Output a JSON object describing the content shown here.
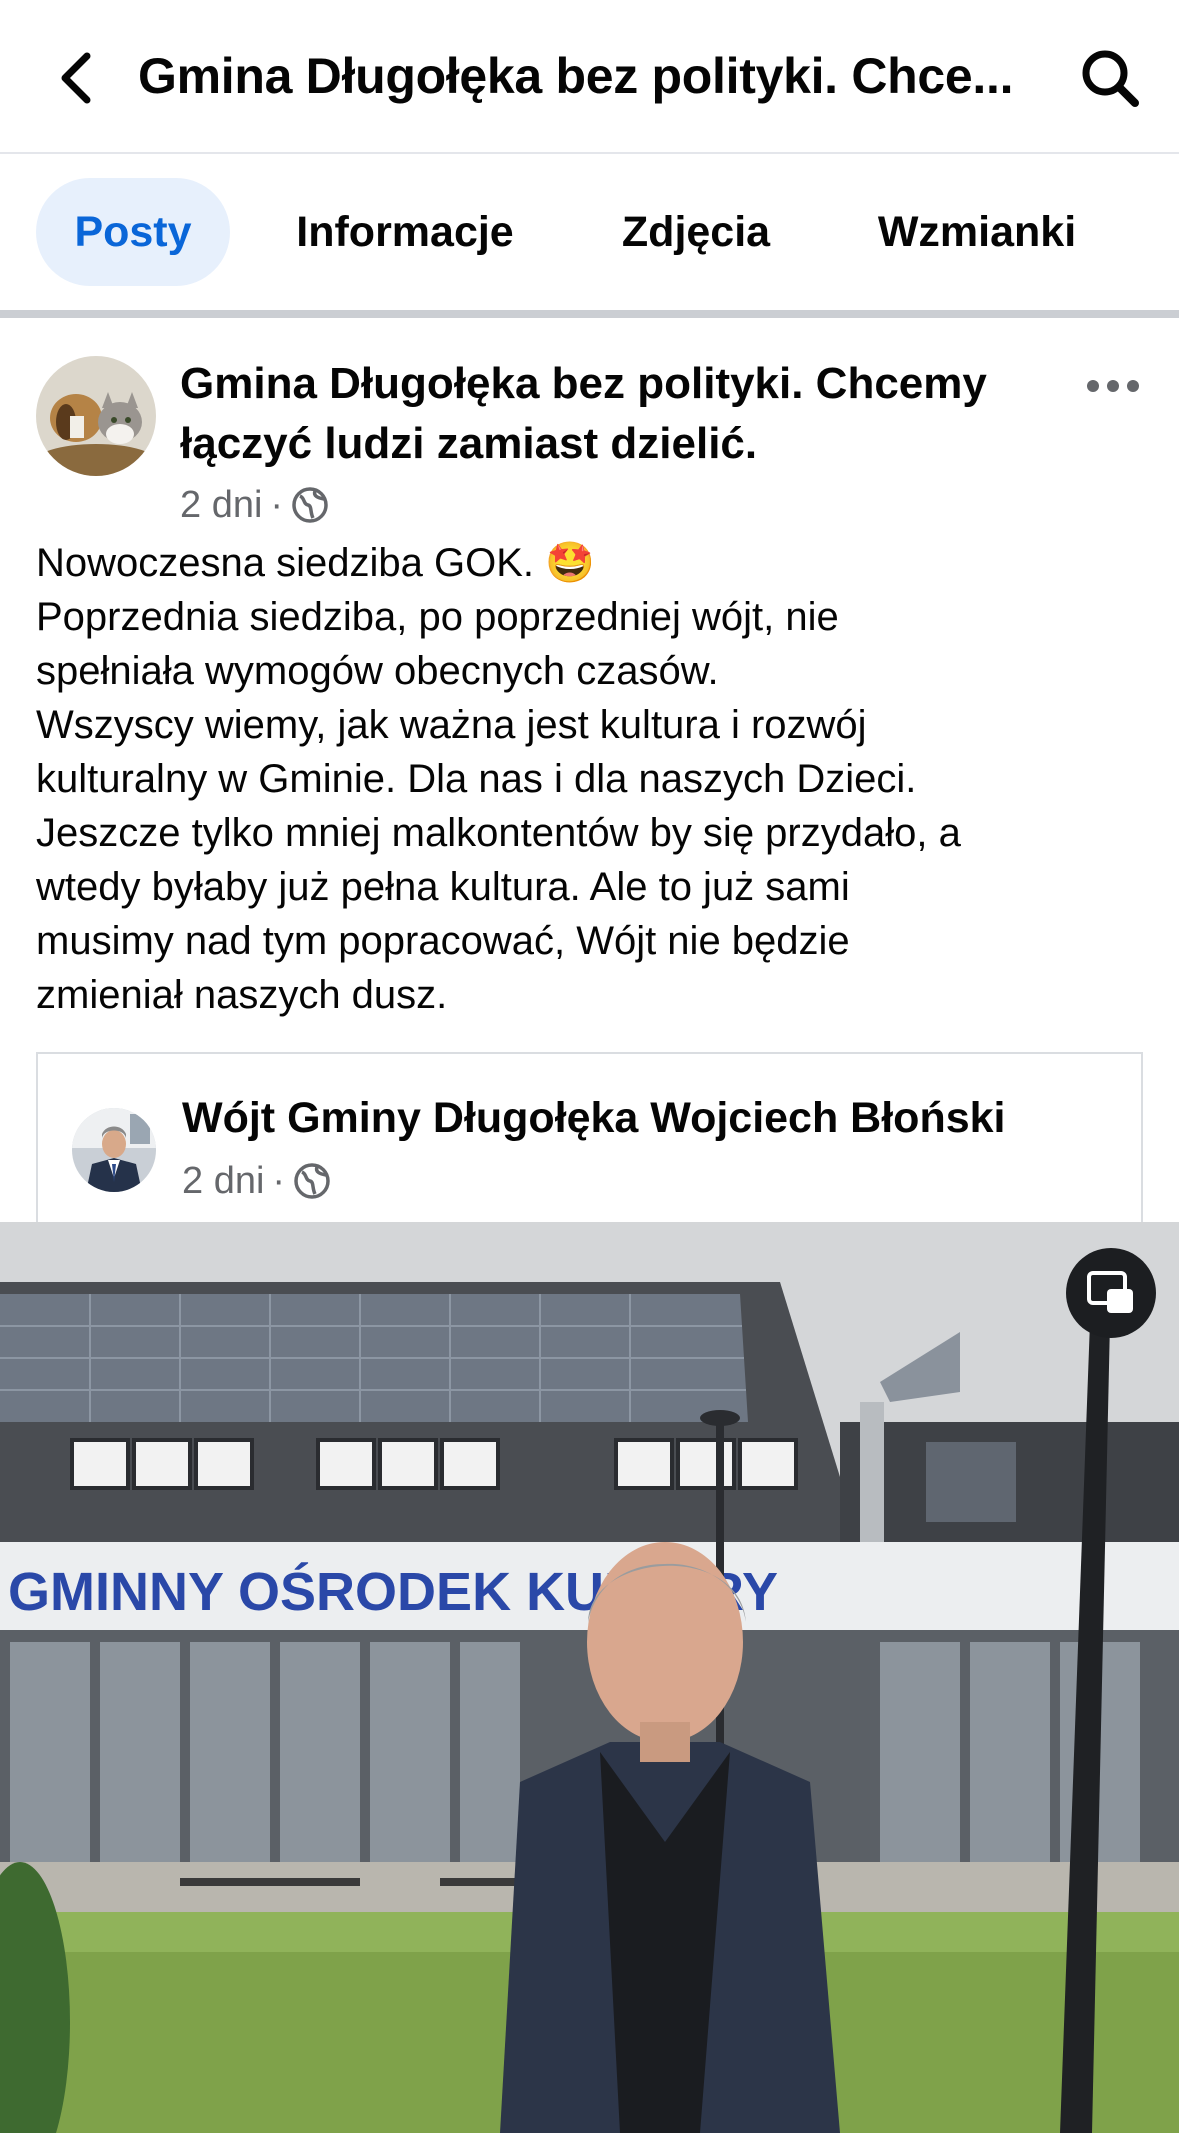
{
  "header": {
    "title": "Gmina Długołęka bez polityki. Chce...",
    "back_icon": "chevron-left-icon",
    "search_icon": "search-icon"
  },
  "tabs": [
    {
      "label": "Posty",
      "active": true
    },
    {
      "label": "Informacje",
      "active": false
    },
    {
      "label": "Zdjęcia",
      "active": false
    },
    {
      "label": "Wzmianki",
      "active": false
    }
  ],
  "post": {
    "author_line1": "Gmina Długołęka bez polityki. Chcemy",
    "author_line2": "łączyć ludzi zamiast dzielić.",
    "time": "2 dni",
    "separator": "·",
    "privacy_icon": "globe-icon",
    "more_icon": "more-horizontal-icon",
    "lines": [
      "Nowoczesna siedziba GOK. 🤩",
      "Poprzednia siedziba, po poprzedniej wójt, nie",
      "spełniała wymogów obecnych czasów.",
      "Wszyscy wiemy, jak ważna jest kultura i rozwój",
      "kulturalny w Gminie. Dla nas i dla naszych Dzieci.",
      "Jeszcze tylko mniej malkontentów by się przydało, a",
      "wtedy byłaby już pełna kultura.  Ale to już sami",
      "musimy nad tym popracować, Wójt nie będzie",
      "zmieniał naszych dusz."
    ]
  },
  "shared": {
    "author": "Wójt Gminy Długołęka Wojciech Błoński",
    "time": "2 dni",
    "separator": "·",
    "privacy_icon": "globe-icon"
  },
  "video": {
    "sign_text": "GMINNY OŚRODEK KULTURY",
    "pip_icon": "picture-in-picture-icon"
  },
  "colors": {
    "accent": "#0a66d8",
    "tab_active_bg": "#e7f0fc",
    "meta_gray": "#65676b",
    "sign_blue": "#2a48a8"
  }
}
